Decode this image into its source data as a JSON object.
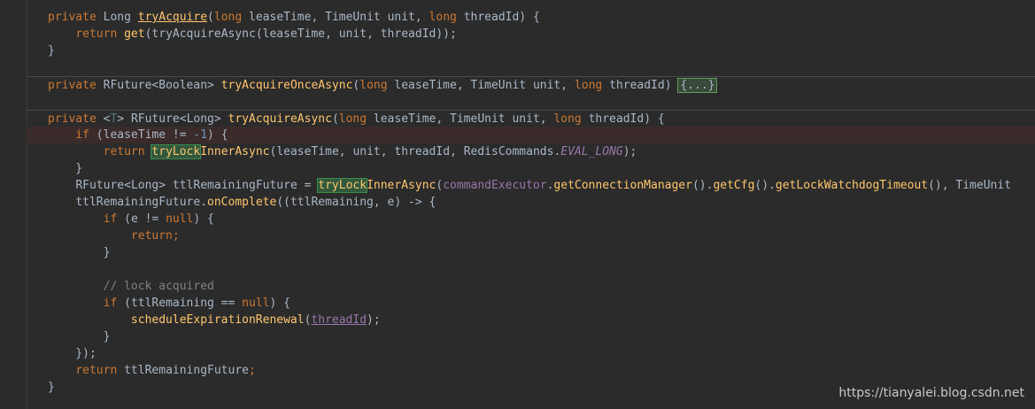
{
  "code_lines": [
    {
      "id": "l1",
      "text": "private Long tryAcquire(long leaseTime, TimeUnit unit, long threadId) {"
    },
    {
      "id": "l2",
      "text": "    return get(tryAcquireAsync(leaseTime, unit, threadId));"
    },
    {
      "id": "l3",
      "text": "}"
    },
    {
      "id": "l4",
      "text": ""
    },
    {
      "id": "l5",
      "text": "private RFuture<Boolean> tryAcquireOnceAsync(long leaseTime, TimeUnit unit, long threadId) {...}"
    },
    {
      "id": "l6",
      "text": ""
    },
    {
      "id": "l7",
      "text": "private <T> RFuture<Long> tryAcquireAsync(long leaseTime, TimeUnit unit, long threadId) {"
    },
    {
      "id": "l8",
      "text": "    if (leaseTime != -1) {"
    },
    {
      "id": "l9",
      "text": "        return tryLockInnerAsync(leaseTime, unit, threadId, RedisCommands.EVAL_LONG);"
    },
    {
      "id": "l10",
      "text": "    }"
    },
    {
      "id": "l11",
      "text": "    RFuture<Long> ttlRemainingFuture = tryLockInnerAsync(commandExecutor.getConnectionManager().getCfg().getLockWatchdogTimeout(), TimeUnit"
    },
    {
      "id": "l12",
      "text": "    ttlRemainingFuture.onComplete((ttlRemaining, e) -> {"
    },
    {
      "id": "l13",
      "text": "        if (e != null) {"
    },
    {
      "id": "l14",
      "text": "            return;"
    },
    {
      "id": "l15",
      "text": "        }"
    },
    {
      "id": "l16",
      "text": ""
    },
    {
      "id": "l17",
      "text": "        // lock acquired"
    },
    {
      "id": "l18",
      "text": "        if (ttlRemaining == null) {"
    },
    {
      "id": "l19",
      "text": "            scheduleExpirationRenewal(threadId);"
    },
    {
      "id": "l20",
      "text": "        }"
    },
    {
      "id": "l21",
      "text": "    });"
    },
    {
      "id": "l22",
      "text": "    return ttlRemainingFuture;"
    },
    {
      "id": "l23",
      "text": "}"
    }
  ],
  "tokens": {
    "private": "private",
    "return": "return",
    "long": "long",
    "if": "if",
    "null": "null",
    "Long": "Long",
    "TimeUnit": "TimeUnit",
    "RFuture": "RFuture",
    "Boolean": "Boolean",
    "T": "T",
    "tryAcquire": "tryAcquire",
    "get": "get",
    "tryAcquireAsync": "tryAcquireAsync",
    "tryAcquireOnceAsync": "tryAcquireOnceAsync",
    "tryLock": "tryLock",
    "InnerAsync": "InnerAsync",
    "leaseTime": "leaseTime",
    "unit": "unit",
    "threadId": "threadId",
    "RedisCommands": "RedisCommands",
    "EVAL_LONG": "EVAL_LONG",
    "ttlRemainingFuture": "ttlRemainingFuture",
    "commandExecutor": "commandExecutor",
    "getConnectionManager": "getConnectionManager",
    "getCfg": "getCfg",
    "getLockWatchdogTimeout": "getLockWatchdogTimeout",
    "onComplete": "onComplete",
    "ttlRemaining": "ttlRemaining",
    "e": "e",
    "minus_one": "-1",
    "comment": "// lock acquired",
    "scheduleExpirationRenewal": "scheduleExpirationRenewal",
    "folded": "{...}"
  },
  "watermark": "https://tianyalei.blog.csdn.net",
  "colors": {
    "background": "#2b2b2b",
    "keyword": "#cc7832",
    "method": "#ffc66d",
    "number": "#6897bb",
    "member": "#9876aa",
    "comment": "#808080",
    "text": "#a9b7c6",
    "highlight": "#32593d",
    "breakpoint_line": "#3b2b2b"
  }
}
